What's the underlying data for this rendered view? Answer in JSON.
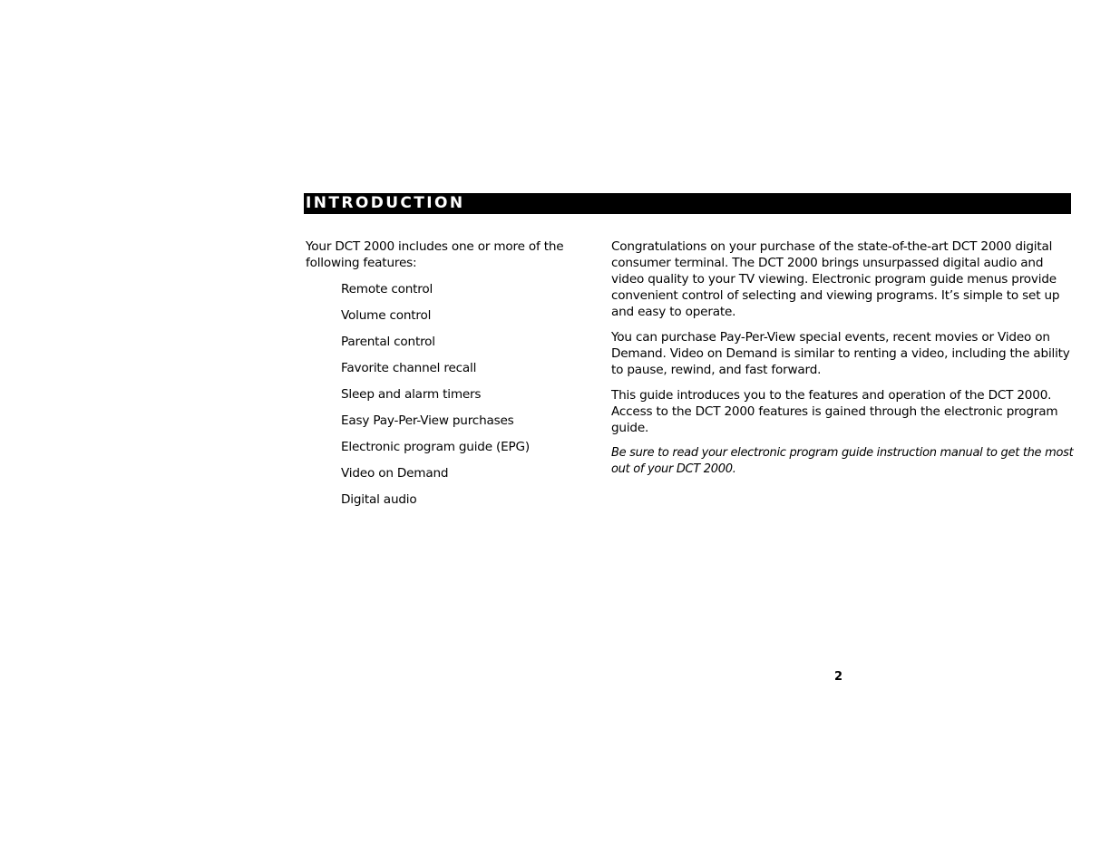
{
  "section": {
    "title": "INTRODUCTION",
    "header_bar_color": "#000000",
    "header_text_color": "#ffffff"
  },
  "left_column": {
    "intro": "Your DCT 2000 includes one or more of the following features:",
    "features": [
      "Remote control",
      "Volume control",
      "Parental control",
      "Favorite channel recall",
      "Sleep and alarm timers",
      "Easy Pay-Per-View purchases",
      "Electronic program guide (EPG)",
      "Video on Demand",
      "Digital audio"
    ]
  },
  "right_column": {
    "paragraphs": [
      "Congratulations on your purchase of the state-of-the-art DCT 2000 digital consumer terminal. The DCT 2000 brings unsurpassed digital audio and video quality to your TV viewing. Electronic program guide menus provide convenient control of selecting and viewing programs. It’s simple to set up and easy to operate.",
      "You can purchase Pay-Per-View special events, recent movies or Video on Demand. Video on Demand is similar to renting a video, including the ability to pause, rewind, and fast forward.",
      "This guide introduces you to the features and operation of the DCT 2000. Access to the DCT 2000 features is gained through the electronic program guide."
    ],
    "note": "Be sure to read your electronic program guide instruction manual to get the most out of your DCT 2000."
  },
  "footer": {
    "page_number": "2"
  }
}
